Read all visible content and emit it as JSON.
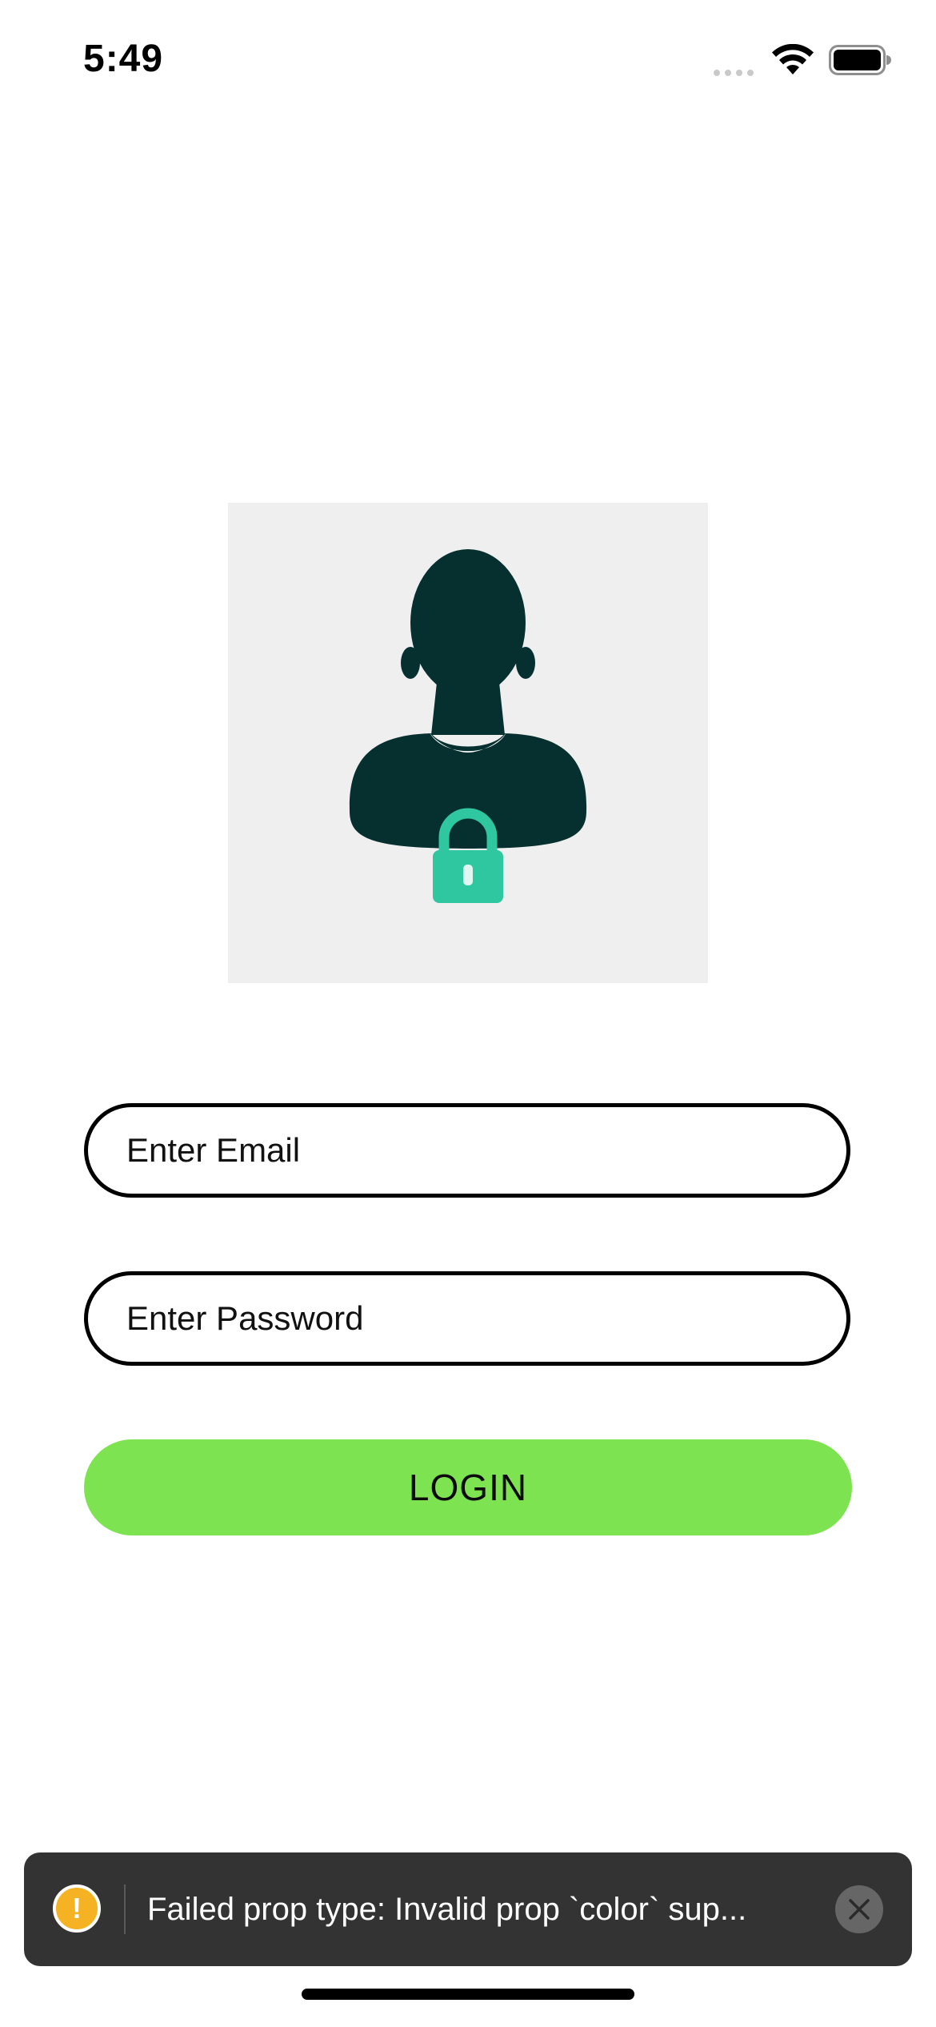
{
  "status_bar": {
    "time": "5:49",
    "icons": [
      "cellular-signal-icon",
      "wifi-icon",
      "battery-icon"
    ]
  },
  "avatar": {
    "icon": "user-lock-icon",
    "colors": {
      "background": "#f0efef",
      "silhouette": "#06302f",
      "lock": "#2ec7a0"
    }
  },
  "form": {
    "email_placeholder": "Enter Email",
    "password_placeholder": "Enter Password",
    "login_label": "LOGIN",
    "login_color": "#7ee350"
  },
  "toast": {
    "icon": "warning-icon",
    "message": "Failed prop type: Invalid prop `color` sup...",
    "close_icon": "close-icon",
    "warning_color": "#f5b323"
  }
}
